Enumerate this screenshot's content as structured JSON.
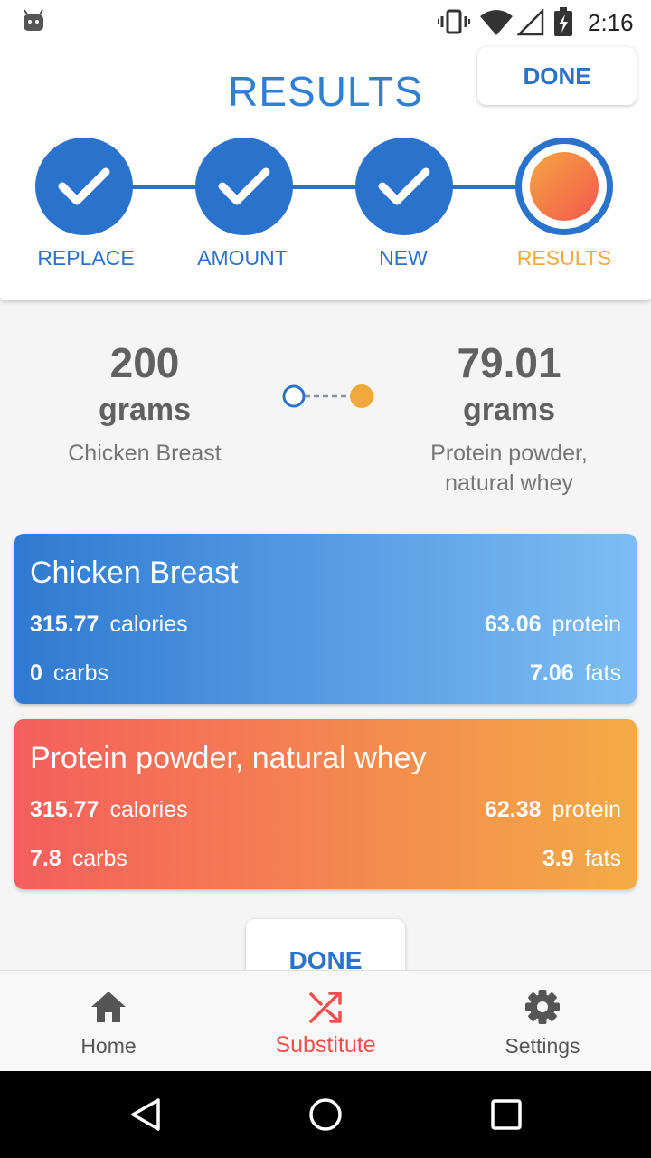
{
  "status_bar": {
    "time": "2:16",
    "icons": [
      "android-icon",
      "vibrate-icon",
      "wifi-icon",
      "signal-icon",
      "battery-icon"
    ]
  },
  "header": {
    "title": "RESULTS",
    "done_label": "DONE"
  },
  "stepper": {
    "steps": [
      {
        "label": "REPLACE",
        "state": "complete"
      },
      {
        "label": "AMOUNT",
        "state": "complete"
      },
      {
        "label": "NEW",
        "state": "complete"
      },
      {
        "label": "RESULTS",
        "state": "current"
      }
    ]
  },
  "comparison": {
    "from": {
      "amount": "200",
      "unit": "grams",
      "food": "Chicken Breast"
    },
    "to": {
      "amount": "79.01",
      "unit": "grams",
      "food_line1": "Protein powder,",
      "food_line2": "natural whey"
    }
  },
  "cards": [
    {
      "title": "Chicken Breast",
      "calories_value": "315.77",
      "calories_label": "calories",
      "protein_value": "63.06",
      "protein_label": "protein",
      "carbs_value": "0",
      "carbs_label": "carbs",
      "fats_value": "7.06",
      "fats_label": "fats"
    },
    {
      "title": "Protein powder, natural whey",
      "calories_value": "315.77",
      "calories_label": "calories",
      "protein_value": "62.38",
      "protein_label": "protein",
      "carbs_value": "7.8",
      "carbs_label": "carbs",
      "fats_value": "3.9",
      "fats_label": "fats"
    }
  ],
  "bottom_done_label": "DONE",
  "bottom_nav": {
    "items": [
      {
        "label": "Home",
        "icon": "home-icon",
        "active": false
      },
      {
        "label": "Substitute",
        "icon": "shuffle-icon",
        "active": true
      },
      {
        "label": "Settings",
        "icon": "gear-icon",
        "active": false
      }
    ]
  },
  "colors": {
    "primary_blue": "#2a73cc",
    "accent_orange": "#f1a93b",
    "accent_red": "#f0504e"
  }
}
